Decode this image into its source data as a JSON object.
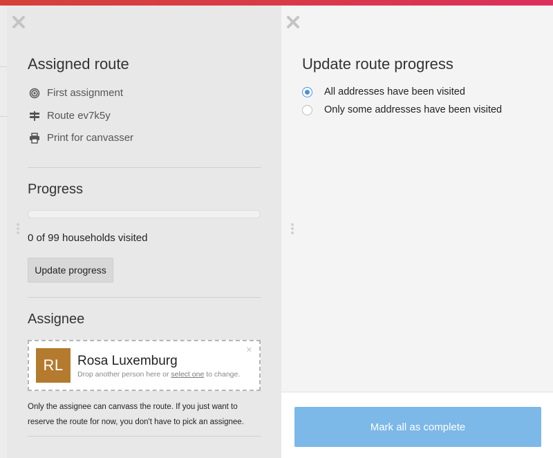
{
  "colors": {
    "accent_blue": "#4a90e2",
    "button_blue": "#7cb8e8",
    "top_bar_red": "#d93a48",
    "avatar_bg": "#b47a2e"
  },
  "left_panel": {
    "title": "Assigned route",
    "links": [
      {
        "icon": "target-icon",
        "label": "First assignment"
      },
      {
        "icon": "signpost-icon",
        "label": "Route ev7k5y"
      },
      {
        "icon": "printer-icon",
        "label": "Print for canvasser"
      }
    ],
    "progress": {
      "title": "Progress",
      "visited_fraction": 0,
      "status_text": "0 of 99 households visited",
      "button_label": "Update progress"
    },
    "assignee": {
      "title": "Assignee",
      "initials": "RL",
      "name": "Rosa Luxemburg",
      "hint_before": "Drop another person here or ",
      "hint_link": "select one",
      "hint_after": " to change.",
      "remove_glyph": "✕",
      "note": "Only the assignee can canvass the route. If you just want to reserve the route for now, you don't have to pick an assignee."
    }
  },
  "right_panel": {
    "title": "Update route progress",
    "options": [
      {
        "label": "All addresses have been visited",
        "selected": true
      },
      {
        "label": "Only some addresses have been visited",
        "selected": false
      }
    ],
    "submit_label": "Mark all as complete"
  }
}
